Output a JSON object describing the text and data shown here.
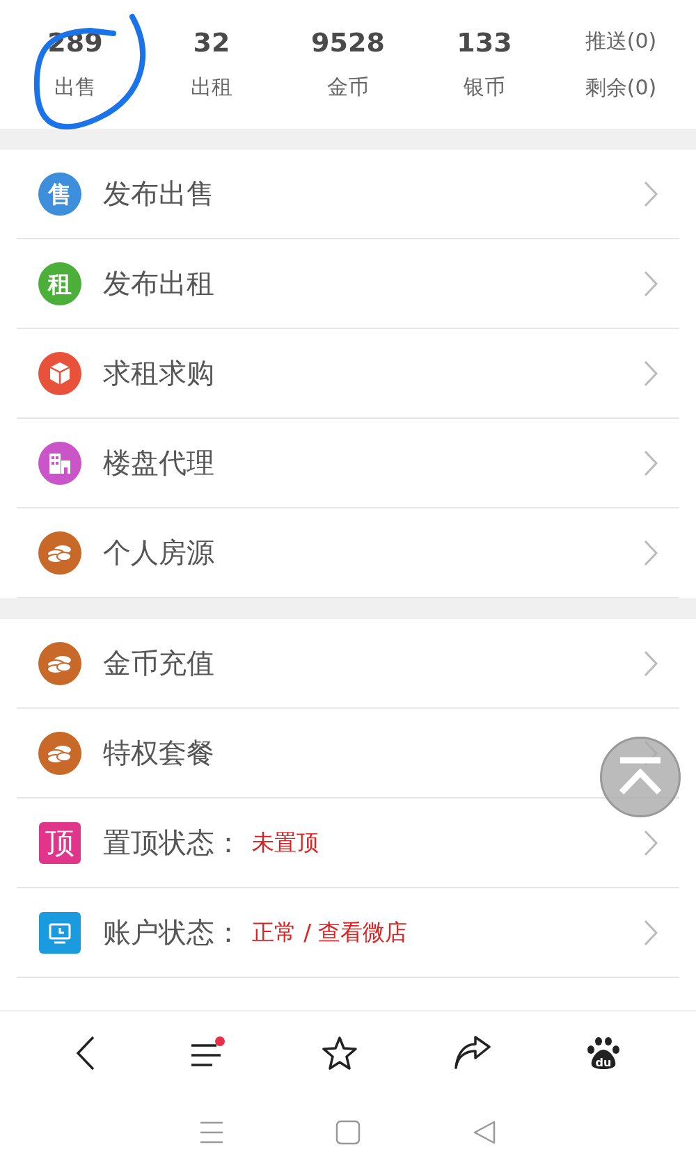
{
  "stats": [
    {
      "value": "289",
      "label": "出售"
    },
    {
      "value": "32",
      "label": "出租"
    },
    {
      "value": "9528",
      "label": "金币"
    },
    {
      "value": "133",
      "label": "银币"
    }
  ],
  "counters": [
    "推送(0)",
    "剩余(0)"
  ],
  "sections": [
    {
      "items": [
        {
          "kind": "link",
          "icon": {
            "kind": "glyph",
            "glyph": "售",
            "color": "#3d8fdc"
          },
          "label": "发布出售"
        },
        {
          "kind": "link",
          "icon": {
            "kind": "glyph",
            "glyph": "租",
            "color": "#4caf3a"
          },
          "label": "发布出租"
        },
        {
          "kind": "link",
          "icon": {
            "kind": "cube",
            "color": "#e8523a"
          },
          "label": "求租求购"
        },
        {
          "kind": "link",
          "icon": {
            "kind": "building",
            "color": "#c955c9"
          },
          "label": "楼盘代理"
        },
        {
          "kind": "link",
          "icon": {
            "kind": "coins",
            "color": "#c8692a"
          },
          "label": "个人房源"
        }
      ]
    },
    {
      "items": [
        {
          "kind": "link",
          "icon": {
            "kind": "coins",
            "color": "#c8692a"
          },
          "label": "金币充值"
        },
        {
          "kind": "link",
          "icon": {
            "kind": "coins",
            "color": "#c8692a"
          },
          "label": "特权套餐"
        },
        {
          "kind": "status",
          "icon": {
            "kind": "square-glyph",
            "glyph": "顶",
            "color": "#e0358a"
          },
          "label": "置顶状态：",
          "value": "未置顶"
        },
        {
          "kind": "status",
          "icon": {
            "kind": "monitor",
            "color": "#1a9be0"
          },
          "label": "账户状态：",
          "value": "正常 / 查看微店"
        }
      ]
    }
  ],
  "toolbar": [
    {
      "kind": "back"
    },
    {
      "kind": "menu",
      "badge": true
    },
    {
      "kind": "star"
    },
    {
      "kind": "share"
    },
    {
      "kind": "paw",
      "logo_text": "du"
    }
  ],
  "navbar": [
    {
      "kind": "menu"
    },
    {
      "kind": "home"
    },
    {
      "kind": "back"
    }
  ]
}
